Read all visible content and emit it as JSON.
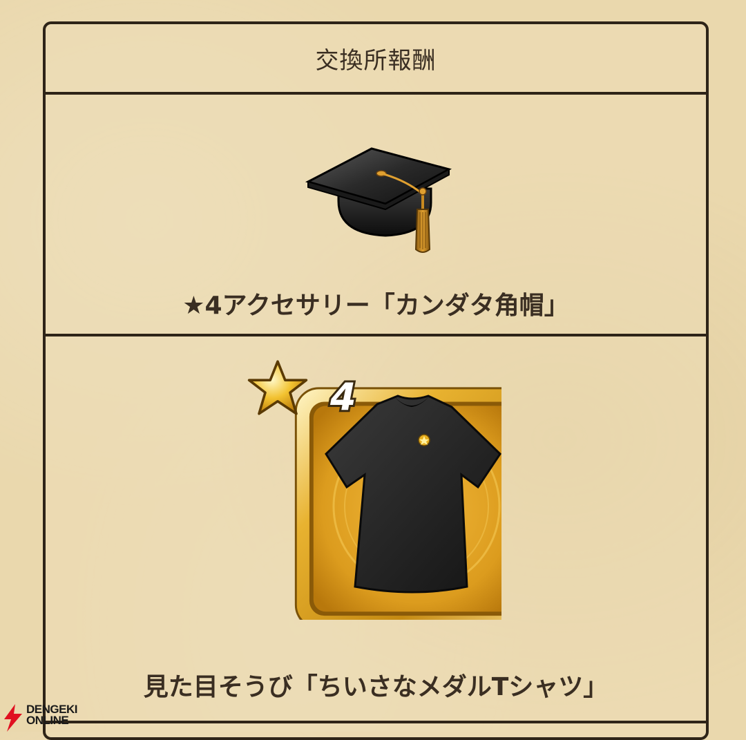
{
  "panel": {
    "title": "交換所報酬"
  },
  "rewards": [
    {
      "name": "★4アクセサリー「カンダタ角帽」",
      "icon": "graduation-cap-icon"
    },
    {
      "name": "見た目そうび「ちいさなメダルTシャツ」",
      "icon": "black-tshirt-icon",
      "rarity": "4"
    }
  ],
  "watermark": {
    "line1": "DENGEKI",
    "line2": "ONLINE"
  },
  "colors": {
    "border": "#2e2418",
    "text": "#3a2e22",
    "frame_gold": "#d9a021",
    "background": "#ead8ad"
  }
}
